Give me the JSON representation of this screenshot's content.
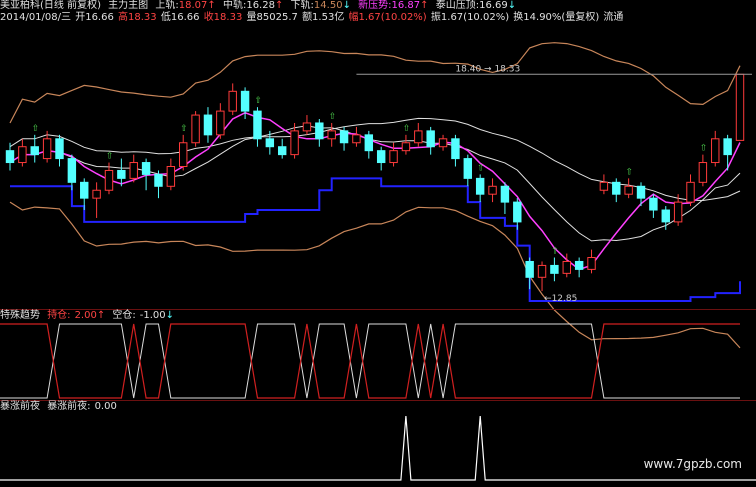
{
  "header": {
    "stock": "美亚柏科(日线 前复权)",
    "indicator": "主力主图",
    "upper_label": "上轨:",
    "upper_value": "18.07",
    "middle_label": "中轨:",
    "middle_value": "16.28",
    "lower_label": "下轨:",
    "lower_value": "14.50",
    "new_pressure_label": "新压势:",
    "new_pressure_value": "16.87",
    "taishan_label": "泰山压顶:",
    "taishan_value": "16.69",
    "arrow_up": "↑",
    "arrow_down": "↓"
  },
  "quote": {
    "date": "2014/01/08/三",
    "open": "开16.66",
    "high": "高18.33",
    "low": "低16.66",
    "close": "收18.33",
    "volume": "量85025.7",
    "amount": "额1.53亿",
    "change": "幅1.67(10.02%)",
    "amplitude": "振1.67(10.02%)",
    "turnover": "换14.90%(量复权)",
    "flow": "流通"
  },
  "annotations": {
    "range_label": "18.40 → 18.33",
    "low_label": "12.85"
  },
  "indicator1": {
    "name": "特殊趋势",
    "hold_label": "持仓:",
    "hold_value": "2.00",
    "empty_label": "空仓:",
    "empty_value": "-1.00"
  },
  "indicator2": {
    "name": "暴涨前夜",
    "label": "暴涨前夜:",
    "value": "0.00"
  },
  "watermark": "www.7gpzb.com",
  "colors": {
    "up": "#ff3b3b",
    "down": "#54ffff",
    "bull": "#ff40ff",
    "support": "#2222ff",
    "band": "#c8865a",
    "mid": "#e0e0e0",
    "marker": "#4cd04c",
    "indicator_red": "#d02020"
  },
  "chart_data": {
    "type": "candlestick",
    "title": "主力主图",
    "price_ylim": [
      12.5,
      19.5
    ],
    "candles": [
      {
        "o": 16.4,
        "c": 16.1,
        "h": 16.6,
        "l": 15.9
      },
      {
        "o": 16.1,
        "c": 16.5,
        "h": 16.7,
        "l": 16.0
      },
      {
        "o": 16.5,
        "c": 16.3,
        "h": 16.8,
        "l": 16.1
      },
      {
        "o": 16.2,
        "c": 16.7,
        "h": 16.9,
        "l": 16.1
      },
      {
        "o": 16.7,
        "c": 16.2,
        "h": 16.8,
        "l": 16.0
      },
      {
        "o": 16.2,
        "c": 15.6,
        "h": 16.3,
        "l": 15.4
      },
      {
        "o": 15.6,
        "c": 15.2,
        "h": 15.7,
        "l": 14.9
      },
      {
        "o": 15.2,
        "c": 15.4,
        "h": 15.6,
        "l": 14.7
      },
      {
        "o": 15.4,
        "c": 15.9,
        "h": 16.1,
        "l": 15.3
      },
      {
        "o": 15.9,
        "c": 15.7,
        "h": 16.2,
        "l": 15.5
      },
      {
        "o": 15.7,
        "c": 16.1,
        "h": 16.3,
        "l": 15.6
      },
      {
        "o": 16.1,
        "c": 15.8,
        "h": 16.2,
        "l": 15.4
      },
      {
        "o": 15.8,
        "c": 15.5,
        "h": 15.9,
        "l": 15.2
      },
      {
        "o": 15.5,
        "c": 16.0,
        "h": 16.2,
        "l": 15.4
      },
      {
        "o": 16.0,
        "c": 16.6,
        "h": 16.8,
        "l": 15.9
      },
      {
        "o": 16.6,
        "c": 17.3,
        "h": 17.4,
        "l": 16.5
      },
      {
        "o": 17.3,
        "c": 16.8,
        "h": 17.5,
        "l": 16.6
      },
      {
        "o": 16.8,
        "c": 17.4,
        "h": 17.6,
        "l": 16.7
      },
      {
        "o": 17.4,
        "c": 17.9,
        "h": 18.1,
        "l": 17.3
      },
      {
        "o": 17.9,
        "c": 17.4,
        "h": 18.0,
        "l": 17.2
      },
      {
        "o": 17.4,
        "c": 16.7,
        "h": 17.5,
        "l": 16.5
      },
      {
        "o": 16.7,
        "c": 16.5,
        "h": 16.9,
        "l": 16.3
      },
      {
        "o": 16.5,
        "c": 16.3,
        "h": 16.7,
        "l": 16.2
      },
      {
        "o": 16.3,
        "c": 16.9,
        "h": 17.1,
        "l": 16.2
      },
      {
        "o": 16.9,
        "c": 17.1,
        "h": 17.3,
        "l": 16.8
      },
      {
        "o": 17.1,
        "c": 16.7,
        "h": 17.2,
        "l": 16.5
      },
      {
        "o": 16.7,
        "c": 16.9,
        "h": 17.1,
        "l": 16.5
      },
      {
        "o": 16.9,
        "c": 16.6,
        "h": 17.0,
        "l": 16.4
      },
      {
        "o": 16.6,
        "c": 16.8,
        "h": 17.0,
        "l": 16.5
      },
      {
        "o": 16.8,
        "c": 16.4,
        "h": 16.9,
        "l": 16.2
      },
      {
        "o": 16.4,
        "c": 16.1,
        "h": 16.5,
        "l": 15.9
      },
      {
        "o": 16.1,
        "c": 16.4,
        "h": 16.6,
        "l": 16.0
      },
      {
        "o": 16.4,
        "c": 16.6,
        "h": 16.8,
        "l": 16.3
      },
      {
        "o": 16.6,
        "c": 16.9,
        "h": 17.1,
        "l": 16.5
      },
      {
        "o": 16.9,
        "c": 16.5,
        "h": 17.0,
        "l": 16.3
      },
      {
        "o": 16.5,
        "c": 16.7,
        "h": 16.8,
        "l": 16.4
      },
      {
        "o": 16.7,
        "c": 16.2,
        "h": 16.8,
        "l": 16.0
      },
      {
        "o": 16.2,
        "c": 15.7,
        "h": 16.3,
        "l": 15.5
      },
      {
        "o": 15.7,
        "c": 15.3,
        "h": 15.8,
        "l": 15.1
      },
      {
        "o": 15.3,
        "c": 15.5,
        "h": 15.7,
        "l": 15.1
      },
      {
        "o": 15.5,
        "c": 15.1,
        "h": 15.6,
        "l": 14.8
      },
      {
        "o": 15.1,
        "c": 14.6,
        "h": 15.2,
        "l": 14.4
      },
      {
        "o": 13.6,
        "c": 13.2,
        "h": 13.7,
        "l": 12.9
      },
      {
        "o": 13.2,
        "c": 13.5,
        "h": 13.6,
        "l": 12.85
      },
      {
        "o": 13.5,
        "c": 13.3,
        "h": 13.7,
        "l": 13.1
      },
      {
        "o": 13.3,
        "c": 13.6,
        "h": 13.8,
        "l": 13.2
      },
      {
        "o": 13.6,
        "c": 13.4,
        "h": 13.7,
        "l": 13.2
      },
      {
        "o": 13.4,
        "c": 13.7,
        "h": 13.9,
        "l": 13.3
      },
      {
        "o": 15.4,
        "c": 15.6,
        "h": 15.8,
        "l": 15.3
      },
      {
        "o": 15.6,
        "c": 15.3,
        "h": 15.7,
        "l": 15.1
      },
      {
        "o": 15.3,
        "c": 15.5,
        "h": 15.7,
        "l": 15.2
      },
      {
        "o": 15.5,
        "c": 15.2,
        "h": 15.6,
        "l": 15.0
      },
      {
        "o": 15.2,
        "c": 14.9,
        "h": 15.3,
        "l": 14.7
      },
      {
        "o": 14.9,
        "c": 14.6,
        "h": 15.0,
        "l": 14.4
      },
      {
        "o": 14.6,
        "c": 15.1,
        "h": 15.3,
        "l": 14.5
      },
      {
        "o": 15.1,
        "c": 15.6,
        "h": 15.8,
        "l": 15.0
      },
      {
        "o": 15.6,
        "c": 16.1,
        "h": 16.3,
        "l": 15.5
      },
      {
        "o": 16.1,
        "c": 16.7,
        "h": 16.9,
        "l": 16.0
      },
      {
        "o": 16.7,
        "c": 16.3,
        "h": 16.8,
        "l": 15.9
      },
      {
        "o": 16.66,
        "c": 18.33,
        "h": 18.33,
        "l": 16.66
      }
    ]
  }
}
